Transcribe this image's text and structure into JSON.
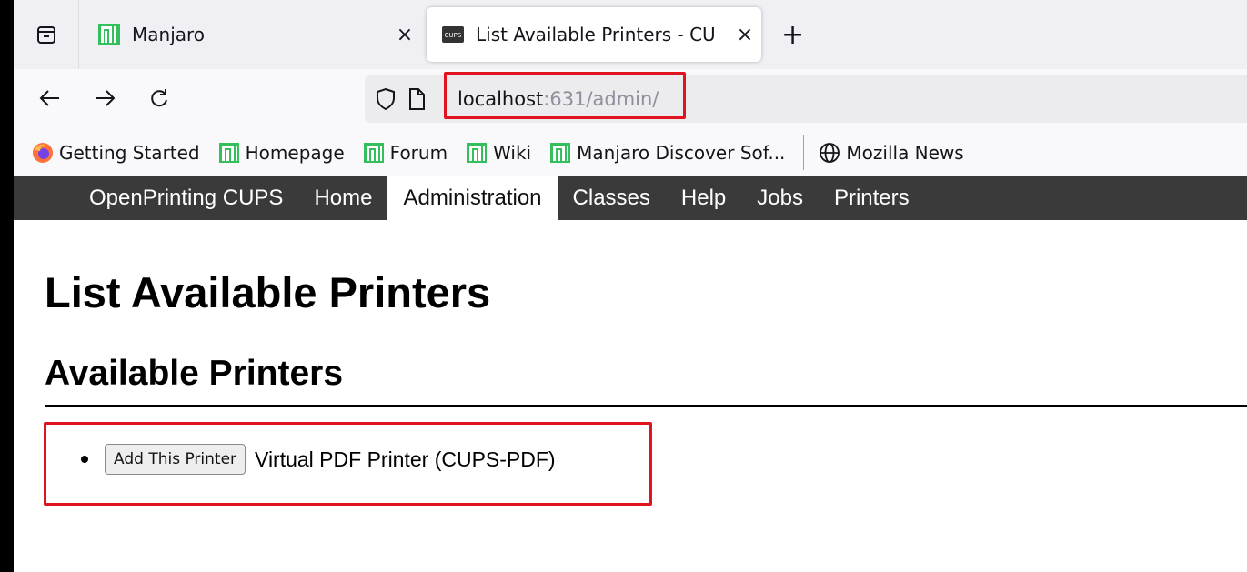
{
  "browser": {
    "tabs": [
      {
        "title": "Manjaro",
        "favicon": "manjaro-icon",
        "close_label": "×",
        "active": false
      },
      {
        "title": "List Available Printers - CU",
        "favicon": "cups-icon",
        "favicon_text": "CUPS",
        "close_label": "×",
        "active": true
      }
    ],
    "new_tab_label": "+",
    "url": {
      "host": "localhost",
      "path": ":631/admin/"
    },
    "bookmarks": [
      {
        "label": "Getting Started",
        "icon": "firefox-icon"
      },
      {
        "label": "Homepage",
        "icon": "manjaro-icon"
      },
      {
        "label": "Forum",
        "icon": "manjaro-icon"
      },
      {
        "label": "Wiki",
        "icon": "manjaro-icon"
      },
      {
        "label": "Manjaro Discover Sof...",
        "icon": "manjaro-icon"
      },
      {
        "label": "Mozilla News",
        "icon": "globe-icon"
      }
    ],
    "colors": {
      "highlight": "#e0141e",
      "manjaro": "#35bf5c"
    }
  },
  "cups_nav": {
    "items": [
      {
        "label": "OpenPrinting CUPS"
      },
      {
        "label": "Home"
      },
      {
        "label": "Administration",
        "active": true
      },
      {
        "label": "Classes"
      },
      {
        "label": "Help"
      },
      {
        "label": "Jobs"
      },
      {
        "label": "Printers"
      }
    ]
  },
  "page": {
    "title": "List Available Printers",
    "section_title": "Available Printers",
    "printers": [
      {
        "button_label": "Add This Printer",
        "name": "Virtual PDF Printer (CUPS-PDF)"
      }
    ]
  }
}
